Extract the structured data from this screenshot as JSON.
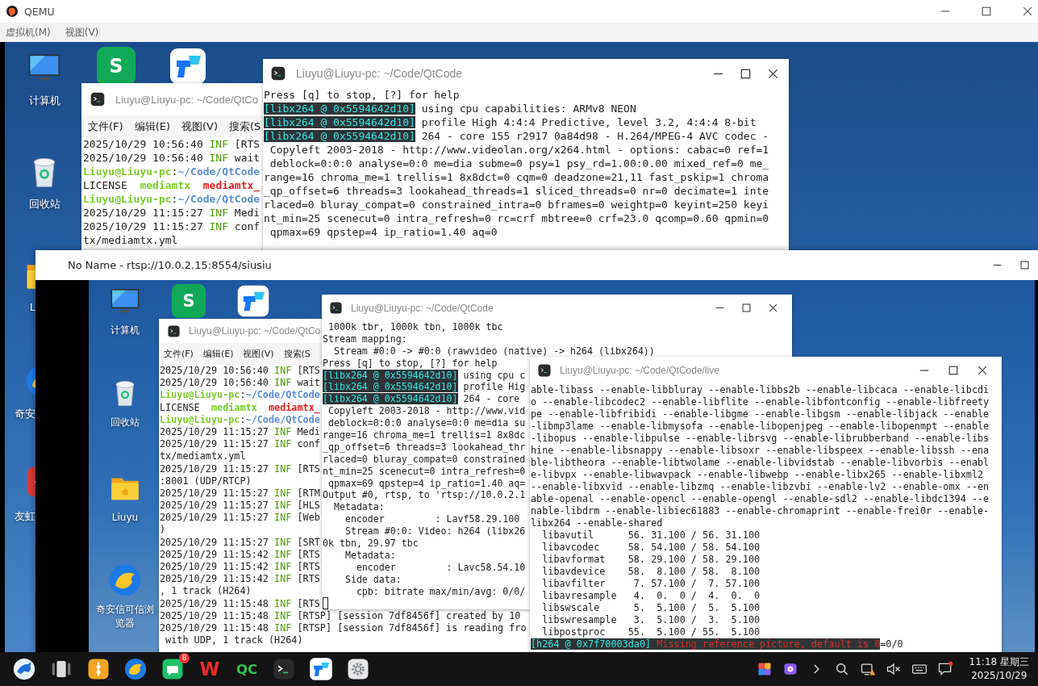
{
  "qemu": {
    "title": "QEMU",
    "menu": [
      {
        "label": "虚拟机(M)"
      },
      {
        "label": "视图(V)"
      }
    ]
  },
  "guest": {
    "icons": [
      {
        "kind": "computer",
        "label": "计算机"
      },
      {
        "kind": "sheets",
        "glyph": "S"
      },
      {
        "kind": "todesk"
      },
      {
        "kind": "trash",
        "label": "回收站"
      },
      {
        "kind": "folder",
        "label": "L"
      },
      {
        "kind": "browser",
        "label": "奇安"
      },
      {
        "kind": "remote",
        "label": "友虹"
      }
    ],
    "terminals": [
      {
        "title": "Liuyu@Liuyu-pc: ~/Code/QtCo",
        "menu": [
          "文件(F)",
          "编辑(E)",
          "视图(V)",
          "搜索(S"
        ],
        "lines": [
          [
            "2025/10/29 10:56:40 ",
            {
              "text": "INF",
              "kind": "info"
            },
            " [RTS"
          ],
          [
            "2025/10/29 10:56:40 ",
            {
              "text": "INF",
              "kind": "info"
            },
            " wait"
          ],
          [
            {
              "text": "Liuyu@Liuyu-pc",
              "kind": "prompt"
            },
            ":",
            {
              "text": "~/Code/QtCode",
              "kind": "path"
            }
          ],
          [
            "LICENSE  ",
            {
              "text": "mediamtx",
              "kind": "exec"
            },
            {
              "text": "  mediamtx_",
              "kind": "archive"
            }
          ],
          [
            {
              "text": "Liuyu@Liuyu-pc",
              "kind": "prompt"
            },
            ":",
            {
              "text": "~/Code/QtCode",
              "kind": "path"
            }
          ],
          [
            "2025/10/29 11:15:27 ",
            {
              "text": "INF",
              "kind": "info"
            },
            " Medi"
          ],
          [
            "2025/10/29 11:15:27 ",
            {
              "text": "INF",
              "kind": "info"
            },
            " conf"
          ],
          "tx/mediamtx.yml"
        ]
      },
      {
        "title": "Liuyu@Liuyu-pc: ~/Code/QtCode",
        "lines": [
          "Press [q] to stop, [?] for help",
          [
            {
              "text": "[libx264 @ 0x5594642d10]",
              "kind": "tag"
            },
            " using cpu capabilities: ARMv8 NEON"
          ],
          [
            {
              "text": "[libx264 @ 0x5594642d10]",
              "kind": "tag"
            },
            " profile High 4:4:4 Predictive, level 3.2, 4:4:4 8-bit"
          ],
          [
            {
              "text": "[libx264 @ 0x5594642d10]",
              "kind": "tag"
            },
            " 264 - core 155 r2917 0a84d98 - H.264/MPEG-4 AVC codec -"
          ],
          " Copyleft 2003-2018 - http://www.videolan.org/x264.html - options: cabac=0 ref=1",
          " deblock=0:0:0 analyse=0:0 me=dia subme=0 psy=1 psy_rd=1.00:0.00 mixed_ref=0 me_",
          "range=16 chroma_me=1 trellis=1 8x8dct=0 cqm=0 deadzone=21,11 fast_pskip=1 chroma",
          "_qp_offset=6 threads=3 lookahead_threads=1 sliced_threads=0 nr=0 decimate=1 inte",
          "rlaced=0 bluray_compat=0 constrained_intra=0 bframes=0 weightp=0 keyint=250 keyi",
          "nt_min=25 scenecut=0 intra_refresh=0 rc=crf mbtree=0 crf=23.0 qcomp=0.60 qpmin=0",
          " qpmax=69 qpstep=4 ip_ratio=1.40 aq=0"
        ]
      }
    ]
  },
  "video_window": {
    "title": "No Name - rtsp://10.0.2.15:8554/siusiu",
    "icons": [
      {
        "kind": "computer",
        "label": "计算机"
      },
      {
        "kind": "sheets",
        "glyph": "S"
      },
      {
        "kind": "todesk"
      },
      {
        "kind": "trash",
        "label": "回收站"
      },
      {
        "kind": "folder",
        "label": "Liuyu"
      },
      {
        "kind": "browser",
        "label": "奇安信可信浏览器"
      }
    ],
    "terminals": [
      {
        "title": "Liuyu@Liuyu-pc: ~/Code/QtCo",
        "menu": [
          "文件(F)",
          "编辑(E)",
          "视图(V)",
          "搜索(S"
        ],
        "lines": [
          [
            "2025/10/29 10:56:40 ",
            {
              "text": "INF",
              "kind": "info"
            },
            " [RTS"
          ],
          [
            "2025/10/29 10:56:40 ",
            {
              "text": "INF",
              "kind": "info"
            },
            " wait"
          ],
          [
            {
              "text": "Liuyu@Liuyu-pc",
              "kind": "prompt"
            },
            ":",
            {
              "text": "~/Code/QtCode",
              "kind": "path"
            }
          ],
          [
            "LICENSE  ",
            {
              "text": "mediamtx",
              "kind": "exec"
            },
            {
              "text": "  mediamtx_",
              "kind": "archive"
            }
          ],
          [
            {
              "text": "Liuyu@Liuyu-pc",
              "kind": "prompt"
            },
            ":",
            {
              "text": "~/Code/QtCode",
              "kind": "path"
            }
          ],
          [
            "2025/10/29 11:15:27 ",
            {
              "text": "INF",
              "kind": "info"
            },
            " Medi"
          ],
          [
            "2025/10/29 11:15:27 ",
            {
              "text": "INF",
              "kind": "info"
            },
            " conf"
          ],
          "tx/mediamtx.yml",
          [
            "2025/10/29 11:15:27 ",
            {
              "text": "INF",
              "kind": "info"
            },
            " [RTS"
          ],
          ":8001 (UDP/RTCP)",
          [
            "2025/10/29 11:15:27 ",
            {
              "text": "INF",
              "kind": "info"
            },
            " [RTM"
          ],
          [
            "2025/10/29 11:15:27 ",
            {
              "text": "INF",
              "kind": "info"
            },
            " [HLS"
          ],
          [
            "2025/10/29 11:15:27 ",
            {
              "text": "INF",
              "kind": "info"
            },
            " [Web"
          ],
          ")",
          [
            "2025/10/29 11:15:27 ",
            {
              "text": "INF",
              "kind": "info"
            },
            " [SRT"
          ],
          [
            "2025/10/29 11:15:42 ",
            {
              "text": "INF",
              "kind": "info"
            },
            " [RTS"
          ],
          [
            "2025/10/29 11:15:42 ",
            {
              "text": "INF",
              "kind": "info"
            },
            " [RTS"
          ],
          [
            "2025/10/29 11:15:42 ",
            {
              "text": "INF",
              "kind": "info"
            },
            " [RTS"
          ],
          ", 1 track (H264)",
          [
            "2025/10/29 11:15:48 ",
            {
              "text": "INF",
              "kind": "info"
            },
            " [RTS"
          ],
          [
            "2025/10/29 11:15:48 ",
            {
              "text": "INF",
              "kind": "info"
            },
            " [RTSP] [session 7df8456f] created by 10"
          ],
          [
            "2025/10/29 11:15:48 ",
            {
              "text": "INF",
              "kind": "info"
            },
            " [RTSP] [session 7df8456f] is reading fro"
          ],
          " with UDP, 1 track (H264)"
        ]
      },
      {
        "title": "Liuyu@Liuyu-pc: ~/Code/QtCode",
        "cursor": true,
        "lines": [
          " 1000k tbr, 1000k tbn, 1000k tbc",
          "Stream mapping:",
          "  Stream #0:0 -> #0:0 (rawvideo (native) -> h264 (libx264))",
          "Press [q] to stop, [?] for help",
          [
            {
              "text": "[libx264 @ 0x5594642d10]",
              "kind": "tag"
            },
            " using cpu c"
          ],
          [
            {
              "text": "[libx264 @ 0x5594642d10]",
              "kind": "tag"
            },
            " profile Hig"
          ],
          [
            {
              "text": "[libx264 @ 0x5594642d10]",
              "kind": "tag"
            },
            " 264 - core"
          ],
          " Copyleft 2003-2018 - http://www.vid",
          " deblock=0:0:0 analyse=0:0 me=dia su",
          "range=16 chroma_me=1 trellis=1 8x8dc",
          "_qp_offset=6 threads=3 lookahead_thr",
          "rlaced=0 bluray_compat=0 constrained",
          "nt_min=25 scenecut=0 intra_refresh=0",
          " qpmax=69 qpstep=4 ip_ratio=1.40 aq=",
          "Output #0, rtsp, to 'rtsp://10.0.2.1",
          "  Metadata:",
          "    encoder         : Lavf58.29.100",
          "    Stream #0:0: Video: h264 (libx26",
          "0k tbn, 29.97 tbc",
          "    Metadata:",
          "      encoder         : Lavc58.54.10",
          "    Side data:",
          "      cpb: bitrate max/min/avg: 0/0/"
        ]
      },
      {
        "title": "Liuyu@Liuyu-pc: ~/Code/QtCode/live",
        "lines": [
          "able-libass --enable-libbluray --enable-libbs2b --enable-libcaca --enable-libcdi",
          "o --enable-libcodec2 --enable-libflite --enable-libfontconfig --enable-libfreety",
          "pe --enable-libfribidi --enable-libgme --enable-libgsm --enable-libjack --enable",
          "-libmp3lame --enable-libmysofa --enable-libopenjpeg --enable-libopenmpt --enable",
          "-libopus --enable-libpulse --enable-librsvg --enable-librubberband --enable-libs",
          "hine --enable-libsnappy --enable-libsoxr --enable-libspeex --enable-libssh --ena",
          "ble-libtheora --enable-libtwolame --enable-libvidstab --enable-libvorbis --enabl",
          "e-libvpx --enable-libwavpack --enable-libwebp --enable-libx265 --enable-libxml2",
          "--enable-libxvid --enable-libzmq --enable-libzvbi --enable-lv2 --enable-omx --en",
          "able-openal --enable-opencl --enable-opengl --enable-sdl2 --enable-libdc1394 --e",
          "nable-libdrm --enable-libiec61883 --enable-chromaprint --enable-frei0r --enable-",
          "libx264 --enable-shared",
          "  libavutil      56. 31.100 / 56. 31.100",
          "  libavcodec     58. 54.100 / 58. 54.100",
          "  libavformat    58. 29.100 / 58. 29.100",
          "  libavdevice    58.  8.100 / 58.  8.100",
          "  libavfilter     7. 57.100 /  7. 57.100",
          "  libavresample   4.  0.  0 /  4.  0.  0",
          "  libswscale      5.  5.100 /  5.  5.100",
          "  libswresample   3.  5.100 /  3.  5.100",
          "  libpostproc    55.  5.100 / 55.  5.100",
          [
            {
              "text": "[h264 @ 0x7f70003da0]",
              "kind": "tag"
            },
            {
              "text": " Missing reference picture, default is 0",
              "kind": "error"
            },
            "=0/0"
          ]
        ]
      }
    ]
  },
  "taskbar": {
    "apps": [
      {
        "kind": "launcher"
      },
      {
        "kind": "multitask"
      },
      {
        "kind": "orange"
      },
      {
        "kind": "browser"
      },
      {
        "kind": "chat",
        "badge": "8"
      },
      {
        "kind": "wps",
        "glyph": "W"
      },
      {
        "kind": "qc",
        "glyph": "QC"
      },
      {
        "kind": "terminal"
      },
      {
        "kind": "todesk"
      },
      {
        "kind": "settings"
      }
    ],
    "tray": [
      {
        "kind": "colorful"
      },
      {
        "kind": "camera"
      },
      {
        "kind": "chevron"
      },
      {
        "kind": "search"
      },
      {
        "kind": "network"
      },
      {
        "kind": "mute"
      },
      {
        "kind": "keyboard"
      },
      {
        "kind": "notification"
      }
    ],
    "time": "11:18 星期三",
    "date": "2025/10/29"
  }
}
